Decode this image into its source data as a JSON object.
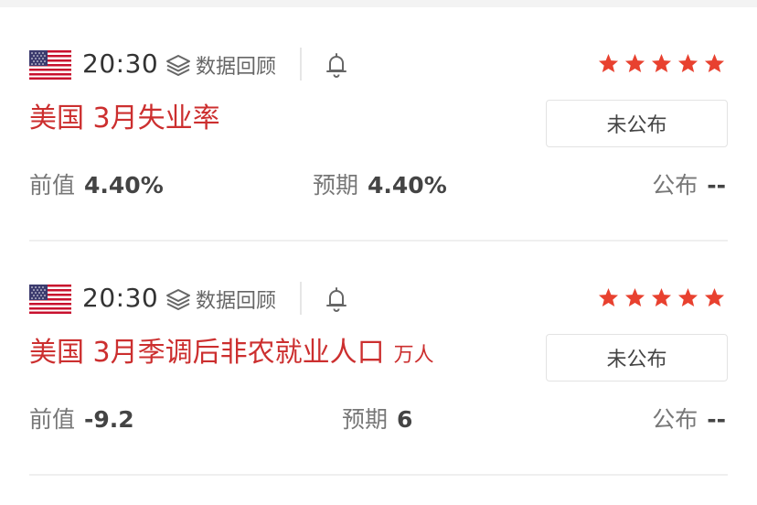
{
  "events": [
    {
      "time": "20:30",
      "review_label": "数据回顾",
      "title": "美国 3月失业率",
      "unit": "",
      "status": "未公布",
      "previous_label": "前值",
      "previous_value": "4.40%",
      "forecast_label": "预期",
      "forecast_value": "4.40%",
      "actual_label": "公布",
      "actual_value": "--",
      "importance": 5,
      "flag_icon": "us-flag-icon"
    },
    {
      "time": "20:30",
      "review_label": "数据回顾",
      "title": "美国 3月季调后非农就业人口",
      "unit": "万人",
      "status": "未公布",
      "previous_label": "前值",
      "previous_value": "-9.2",
      "forecast_label": "预期",
      "forecast_value": "6",
      "actual_label": "公布",
      "actual_value": "--",
      "importance": 5,
      "flag_icon": "us-flag-icon"
    }
  ],
  "colors": {
    "title": "#cc2f2f",
    "star": "#e8412f",
    "text_secondary": "#777777"
  }
}
